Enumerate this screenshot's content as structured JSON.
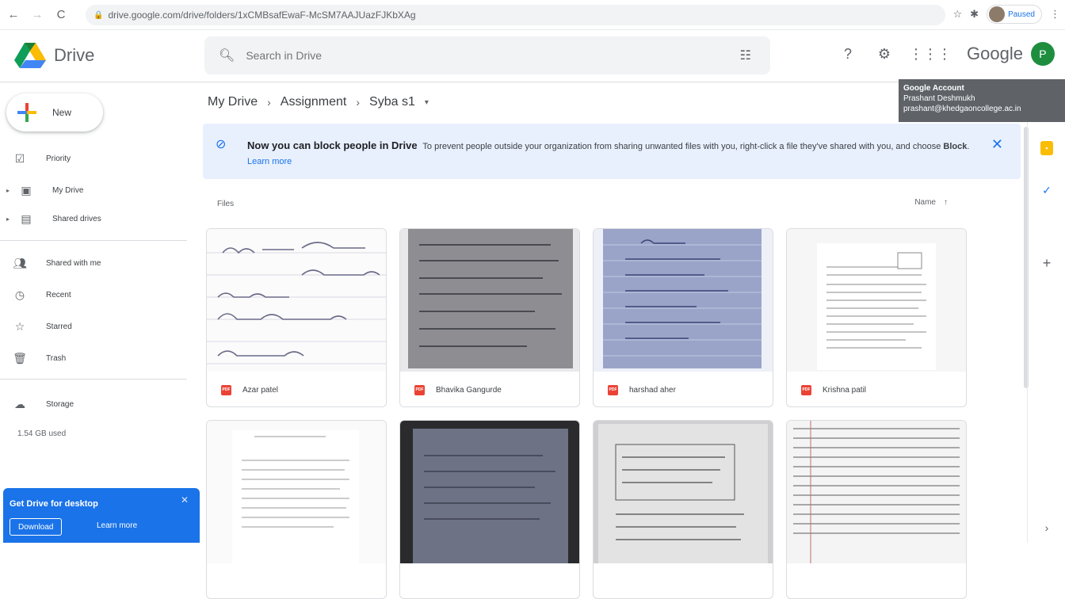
{
  "browser": {
    "url": "drive.google.com/drive/folders/1xCMBsafEwaF-McSM7AAJUazFJKbXAg",
    "paused_label": "Paused"
  },
  "header": {
    "app_name": "Drive",
    "search_placeholder": "Search in Drive",
    "brand": "Google",
    "avatar_letter": "P"
  },
  "tooltip": {
    "title": "Google Account",
    "name": "Prashant Deshmukh",
    "email": "prashant@khedgaoncollege.ac.in"
  },
  "sidebar": {
    "new_label": "New",
    "items": [
      {
        "label": "Priority",
        "icon": "priority-icon"
      },
      {
        "label": "My Drive",
        "icon": "my-drive-icon"
      },
      {
        "label": "Shared drives",
        "icon": "shared-drives-icon"
      },
      {
        "label": "Shared with me",
        "icon": "people-icon"
      },
      {
        "label": "Recent",
        "icon": "clock-icon"
      },
      {
        "label": "Starred",
        "icon": "star-icon"
      },
      {
        "label": "Trash",
        "icon": "trash-icon"
      },
      {
        "label": "Storage",
        "icon": "cloud-icon"
      }
    ],
    "storage_used": "1.54 GB used"
  },
  "promo": {
    "title": "Get Drive for desktop",
    "download": "Download",
    "learn_more": "Learn more"
  },
  "breadcrumb": [
    "My Drive",
    "Assignment",
    "Syba s1"
  ],
  "banner": {
    "title": "Now you can block people in Drive",
    "text_before": "To prevent people outside your organization from sharing unwanted files with you, right-click a file they've shared with you, and choose",
    "block": "Block",
    "learn_more": "Learn more"
  },
  "files": {
    "section_label": "Files",
    "sort_label": "Name",
    "sort_arrow": "↑",
    "items": [
      {
        "name": "Azar patel",
        "type": "pdf"
      },
      {
        "name": "Bhavika Gangurde",
        "type": "pdf"
      },
      {
        "name": "harshad aher",
        "type": "pdf"
      },
      {
        "name": "Krishna patil",
        "type": "pdf"
      }
    ]
  },
  "colors": {
    "accent": "#1a73e8",
    "pdf": "#ea4335",
    "avatar": "#1e8e3e",
    "banner_bg": "#e8f0fe"
  }
}
